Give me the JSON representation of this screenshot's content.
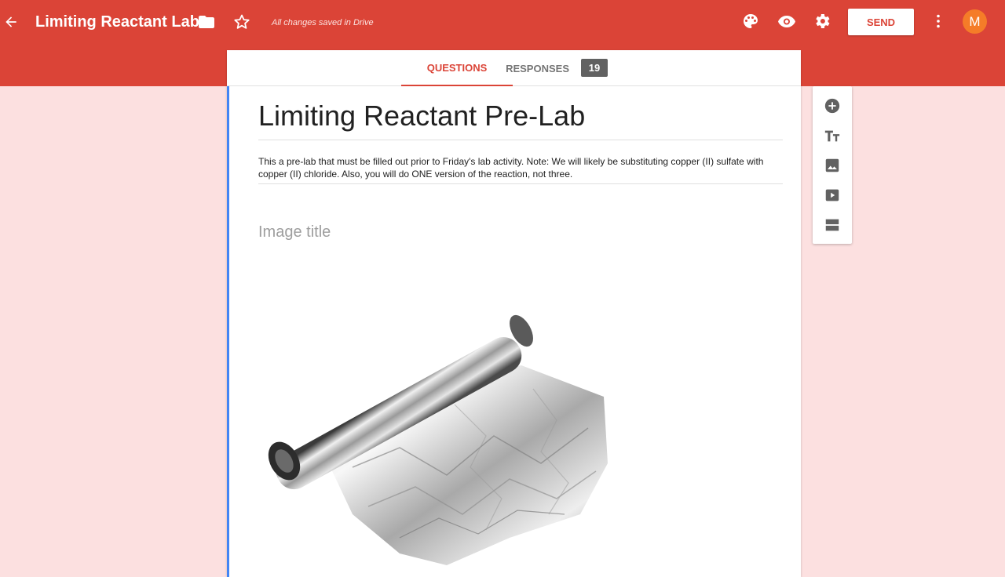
{
  "header": {
    "title": "Limiting Reactant Lab",
    "saved_status": "All changes saved in Drive",
    "send_label": "SEND",
    "avatar_initial": "M",
    "icons": [
      "back-arrow-icon",
      "folder-icon",
      "star-icon",
      "palette-icon",
      "eye-icon",
      "gear-icon",
      "more-vert-icon"
    ]
  },
  "tabs": {
    "questions_label": "QUESTIONS",
    "responses_label": "RESPONSES",
    "responses_count": "19"
  },
  "form": {
    "title": "Limiting Reactant Pre-Lab",
    "description": "This a pre-lab that must be filled out prior to Friday's lab activity. Note: We will likely be substituting copper (II) sulfate with copper (II) chloride. Also, you will do ONE version of the reaction, not three.",
    "image_title_placeholder": "Image title"
  },
  "side_toolbar": {
    "icons": [
      "add-question-icon",
      "title-text-icon",
      "image-icon",
      "video-icon",
      "section-icon"
    ]
  },
  "colors": {
    "accent": "#db4437",
    "background": "#fce0e0",
    "left_border": "#4285f4",
    "avatar": "#f57c28"
  }
}
